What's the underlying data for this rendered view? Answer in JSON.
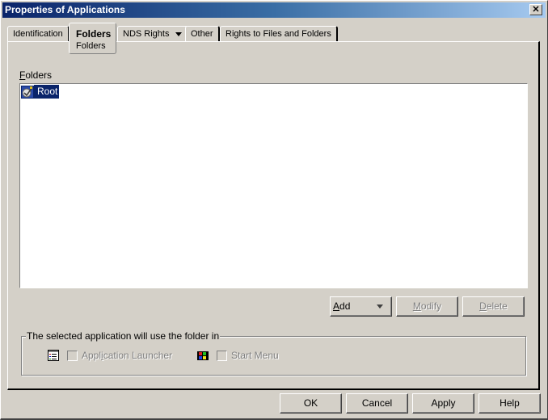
{
  "window": {
    "title": "Properties of Applications",
    "close_label": "✕"
  },
  "tabs": [
    {
      "label": "Identification",
      "active": false
    },
    {
      "label": "Folders",
      "sublabel": "Folders",
      "active": true
    },
    {
      "label": "NDS Rights",
      "has_dropdown": true,
      "active": false
    },
    {
      "label": "Other",
      "active": false
    },
    {
      "label": "Rights to Files and Folders",
      "active": false
    }
  ],
  "folders": {
    "label_accel": "F",
    "label_rest": "olders",
    "items": [
      {
        "label": "Root",
        "icon": "folder-object-icon",
        "selected": true
      }
    ],
    "add": {
      "accel": "A",
      "rest": "dd"
    },
    "modify": {
      "accel": "M",
      "rest": "odify"
    },
    "delete": {
      "accel": "D",
      "rest": "elete"
    }
  },
  "group": {
    "legend": "The selected application will use the folder in",
    "options": [
      {
        "label_pre": "Appl",
        "label_accel": "i",
        "label_post": "cation Launcher",
        "checked": false,
        "enabled": false,
        "icon": "application-launcher-icon"
      },
      {
        "label": "Start Menu",
        "checked": false,
        "enabled": false,
        "icon": "start-menu-icon"
      }
    ]
  },
  "footer": {
    "ok": "OK",
    "cancel": "Cancel",
    "apply": "Apply",
    "help": "Help"
  }
}
